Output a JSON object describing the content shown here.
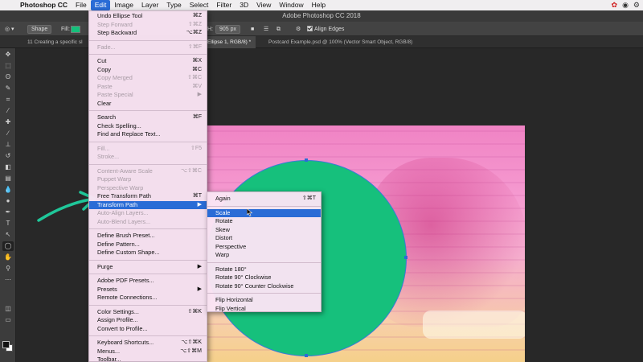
{
  "menubar": {
    "items": [
      "Photoshop CC",
      "File",
      "Edit",
      "Image",
      "Layer",
      "Type",
      "Select",
      "Filter",
      "3D",
      "View",
      "Window",
      "Help"
    ],
    "active_index": 2
  },
  "titlebar": {
    "title": "Adobe Photoshop CC 2018"
  },
  "options": {
    "mode": "Shape",
    "fill_label": "Fill:",
    "h_label": "H:",
    "h_value": "905 px",
    "align_edges": "Align Edges",
    "fill_color": "#14c07b"
  },
  "tabs": [
    {
      "label": "11 Creating a specific sl"
    },
    {
      "label": "Ellipse 1, RGB/8) *"
    },
    {
      "label": "Postcard Example.psd @ 100% (Vector Smart Object, RGB/8)"
    }
  ],
  "edit_menu": {
    "groups": [
      [
        {
          "label": "Undo Ellipse Tool",
          "shortcut": "⌘Z",
          "disabled": false
        },
        {
          "label": "Step Forward",
          "shortcut": "⇧⌘Z",
          "disabled": true
        },
        {
          "label": "Step Backward",
          "shortcut": "⌥⌘Z",
          "disabled": false
        }
      ],
      [
        {
          "label": "Fade...",
          "shortcut": "⇧⌘F",
          "disabled": true
        }
      ],
      [
        {
          "label": "Cut",
          "shortcut": "⌘X",
          "disabled": false
        },
        {
          "label": "Copy",
          "shortcut": "⌘C",
          "disabled": false
        },
        {
          "label": "Copy Merged",
          "shortcut": "⇧⌘C",
          "disabled": true
        },
        {
          "label": "Paste",
          "shortcut": "⌘V",
          "disabled": true
        },
        {
          "label": "Paste Special",
          "shortcut": "▶",
          "disabled": true
        },
        {
          "label": "Clear",
          "shortcut": "",
          "disabled": false
        }
      ],
      [
        {
          "label": "Search",
          "shortcut": "⌘F",
          "disabled": false
        },
        {
          "label": "Check Spelling...",
          "shortcut": "",
          "disabled": false
        },
        {
          "label": "Find and Replace Text...",
          "shortcut": "",
          "disabled": false
        }
      ],
      [
        {
          "label": "Fill...",
          "shortcut": "⇧F5",
          "disabled": true
        },
        {
          "label": "Stroke...",
          "shortcut": "",
          "disabled": true
        }
      ],
      [
        {
          "label": "Content-Aware Scale",
          "shortcut": "⌥⇧⌘C",
          "disabled": true
        },
        {
          "label": "Puppet Warp",
          "shortcut": "",
          "disabled": true
        },
        {
          "label": "Perspective Warp",
          "shortcut": "",
          "disabled": true
        },
        {
          "label": "Free Transform Path",
          "shortcut": "⌘T",
          "disabled": false
        },
        {
          "label": "Transform Path",
          "shortcut": "▶",
          "disabled": false,
          "highlight": true
        },
        {
          "label": "Auto-Align Layers...",
          "shortcut": "",
          "disabled": true
        },
        {
          "label": "Auto-Blend Layers...",
          "shortcut": "",
          "disabled": true
        }
      ],
      [
        {
          "label": "Define Brush Preset...",
          "shortcut": "",
          "disabled": false
        },
        {
          "label": "Define Pattern...",
          "shortcut": "",
          "disabled": false
        },
        {
          "label": "Define Custom Shape...",
          "shortcut": "",
          "disabled": false
        }
      ],
      [
        {
          "label": "Purge",
          "shortcut": "▶",
          "disabled": false
        }
      ],
      [
        {
          "label": "Adobe PDF Presets...",
          "shortcut": "",
          "disabled": false
        },
        {
          "label": "Presets",
          "shortcut": "▶",
          "disabled": false
        },
        {
          "label": "Remote Connections...",
          "shortcut": "",
          "disabled": false
        }
      ],
      [
        {
          "label": "Color Settings...",
          "shortcut": "⇧⌘K",
          "disabled": false
        },
        {
          "label": "Assign Profile...",
          "shortcut": "",
          "disabled": false
        },
        {
          "label": "Convert to Profile...",
          "shortcut": "",
          "disabled": false
        }
      ],
      [
        {
          "label": "Keyboard Shortcuts...",
          "shortcut": "⌥⇧⌘K",
          "disabled": false
        },
        {
          "label": "Menus...",
          "shortcut": "⌥⇧⌘M",
          "disabled": false
        },
        {
          "label": "Toolbar...",
          "shortcut": "",
          "disabled": false
        }
      ]
    ]
  },
  "transform_submenu": {
    "groups": [
      [
        {
          "label": "Again",
          "shortcut": "⇧⌘T"
        }
      ],
      [
        {
          "label": "Scale",
          "shortcut": "",
          "highlight": true
        },
        {
          "label": "Rotate",
          "shortcut": ""
        },
        {
          "label": "Skew",
          "shortcut": ""
        },
        {
          "label": "Distort",
          "shortcut": ""
        },
        {
          "label": "Perspective",
          "shortcut": ""
        },
        {
          "label": "Warp",
          "shortcut": ""
        }
      ],
      [
        {
          "label": "Rotate 180°",
          "shortcut": ""
        },
        {
          "label": "Rotate 90° Clockwise",
          "shortcut": ""
        },
        {
          "label": "Rotate 90° Counter Clockwise",
          "shortcut": ""
        }
      ],
      [
        {
          "label": "Flip Horizontal",
          "shortcut": ""
        },
        {
          "label": "Flip Vertical",
          "shortcut": ""
        }
      ]
    ]
  },
  "colors": {
    "accent": "#2a6cd6",
    "shape_fill": "#16c07c",
    "annotation_arrow": "#1fc79a"
  }
}
